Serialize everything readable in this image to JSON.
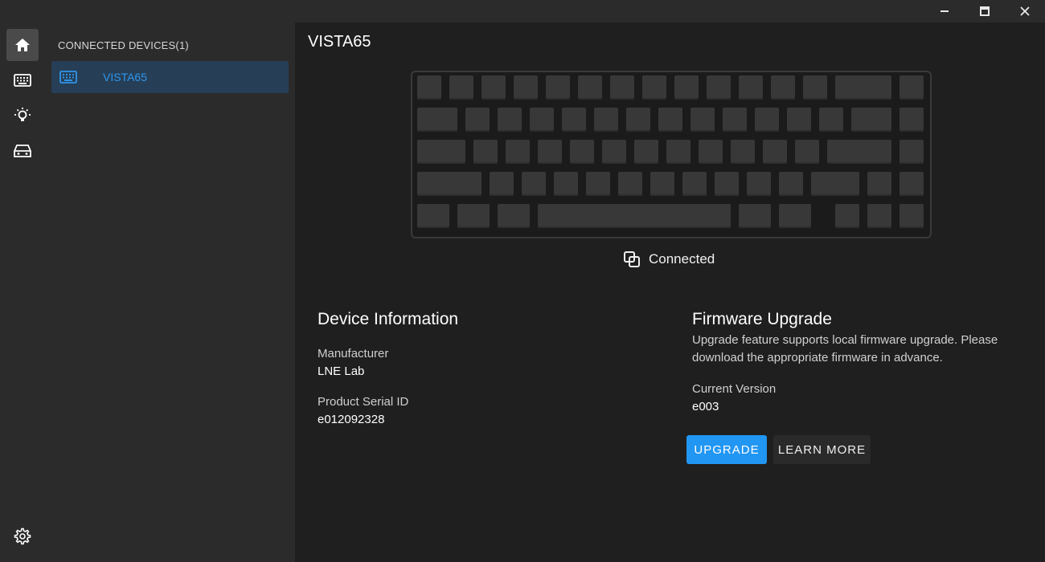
{
  "window": {
    "controls": [
      "minimize-icon",
      "maximize-icon",
      "close-icon"
    ]
  },
  "rail": {
    "items": [
      {
        "icon": "home-icon",
        "active": true
      },
      {
        "icon": "keyboard-icon",
        "active": false
      },
      {
        "icon": "lightbulb-icon",
        "active": false
      },
      {
        "icon": "drive-icon",
        "active": false
      }
    ],
    "settings_icon": "gear-icon"
  },
  "devices": {
    "header": "CONNECTED DEVICES(1)",
    "items": [
      {
        "label": "VISTA65",
        "icon": "keyboard-icon",
        "selected": true
      }
    ]
  },
  "main": {
    "title": "VISTA65",
    "status": "Connected",
    "device_info": {
      "title": "Device Information",
      "manufacturer_label": "Manufacturer",
      "manufacturer_value": "LNE Lab",
      "serial_label": "Product Serial ID",
      "serial_value": "e012092328"
    },
    "firmware": {
      "title": "Firmware Upgrade",
      "description": "Upgrade feature supports local firmware upgrade. Please download the appropriate firmware in advance.",
      "version_label": "Current Version",
      "version_value": "e003",
      "upgrade_button": "UPGRADE",
      "learn_more_button": "LEARN MORE"
    }
  },
  "colors": {
    "accent": "#2196f3",
    "selected_text": "#2f95ec",
    "selected_bg": "#263f57"
  }
}
